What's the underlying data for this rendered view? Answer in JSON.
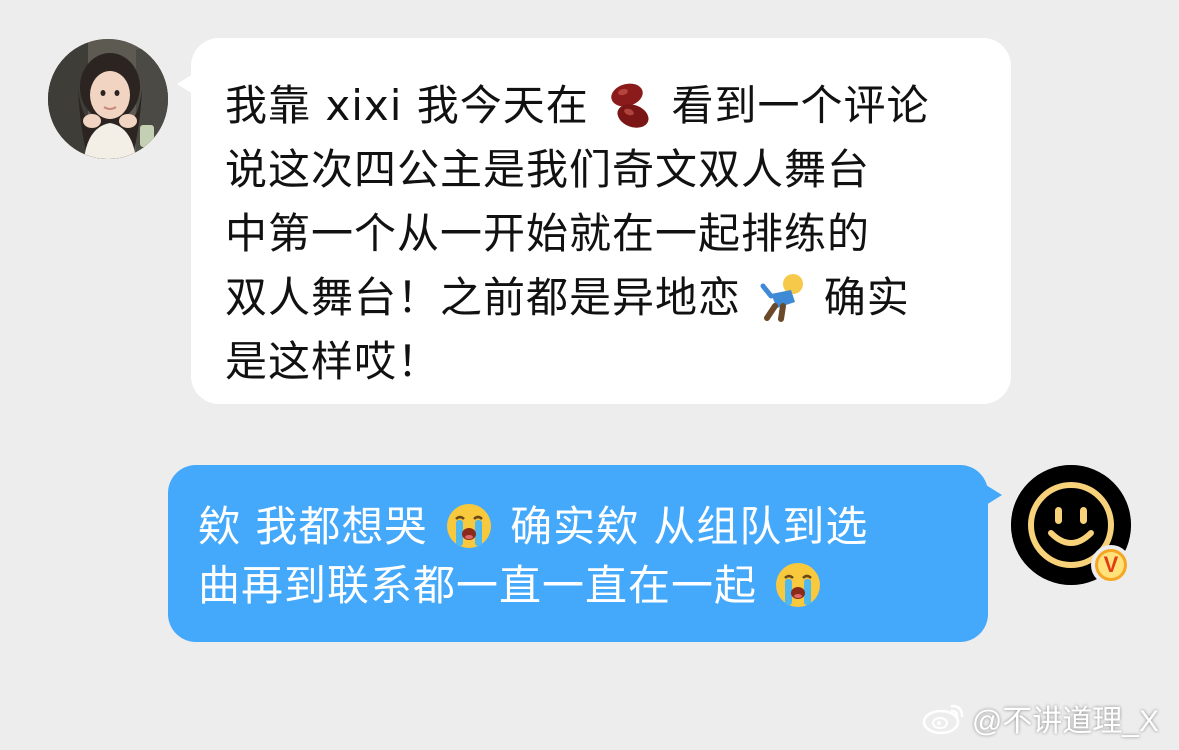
{
  "conversation": {
    "incoming": {
      "lines": [
        {
          "a": "我靠 xixi 我今天在",
          "b": "看到一个评论"
        },
        {
          "text": "说这次四公主是我们奇文双人舞台"
        },
        {
          "text": "中第一个从一开始就在一起排练的"
        },
        {
          "a": "双人舞台！之前都是异地恋",
          "b": "确实"
        },
        {
          "text": "是这样哎！"
        }
      ],
      "emoji_beans": "beans-emoji",
      "emoji_fall": "person-falling-emoji"
    },
    "outgoing": {
      "lines": [
        {
          "a": "欸 我都想哭",
          "b": "确实欸 从组队到选"
        },
        {
          "a": "曲再到联系都一直一直在一起",
          "b": ""
        }
      ],
      "emoji_cry": "loudly-crying-face-emoji"
    },
    "avatars": {
      "left": "user-photo-avatar",
      "right": "smiley-face-avatar",
      "badge": "V"
    }
  },
  "watermark": {
    "text": "@不讲道理_X",
    "icon": "weibo-icon"
  },
  "colors": {
    "background": "#ededed",
    "incoming_bubble": "#ffffff",
    "outgoing_bubble": "#44a8fb",
    "badge": "#f5a623"
  }
}
